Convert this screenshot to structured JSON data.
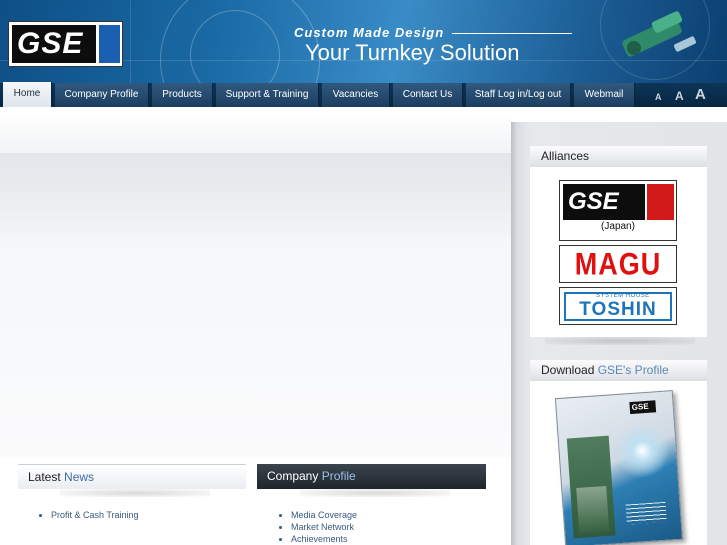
{
  "header": {
    "logo_text": "GSE",
    "tagline_small": "Custom Made Design",
    "tagline_big": "Your Turnkey Solution"
  },
  "nav": {
    "tabs": [
      {
        "label": "Home",
        "active": true
      },
      {
        "label": "Company Profile"
      },
      {
        "label": "Products"
      },
      {
        "label": "Support & Training"
      },
      {
        "label": "Vacancies"
      },
      {
        "label": "Contact Us"
      },
      {
        "label": "Staff Log in/Log out"
      },
      {
        "label": "Webmail"
      }
    ],
    "font_sizes": [
      "A",
      "A",
      "A"
    ]
  },
  "news": {
    "title_prefix": "Latest",
    "title_highlight": "News",
    "items": [
      "Profit & Cash Training"
    ]
  },
  "profile": {
    "title_prefix": "Company",
    "title_highlight": "Profile",
    "items": [
      "Media Coverage",
      "Market Network",
      "Achievements"
    ]
  },
  "sidebar": {
    "alliances_title": "Alliances",
    "alliances": {
      "gse_japan": {
        "logo_text": "GSE",
        "caption": "(Japan)"
      },
      "magu": {
        "logo_text": "MAGU"
      },
      "toshin": {
        "subtitle": "SYSTEM HOUSE",
        "logo_text": "TOSHIN"
      }
    },
    "download_prefix": "Download",
    "download_highlight": "GSE's Profile",
    "brochure_logo": "GSE"
  },
  "colors": {
    "banner_blue": "#1a6aa5",
    "nav_dark": "#0d3558",
    "link_blue": "#3a5a80",
    "highlight_blue": "#3a6ea5",
    "gse_red": "#d21a1a",
    "magu_red": "#e01010",
    "toshin_blue": "#1d74b8"
  }
}
